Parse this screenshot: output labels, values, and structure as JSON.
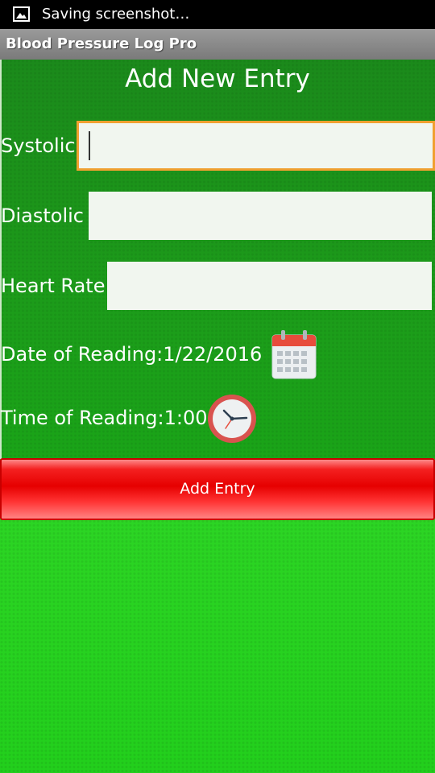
{
  "status_bar": {
    "icon": "image-icon",
    "text": "Saving screenshot…"
  },
  "app": {
    "title": "Blood Pressure Log Pro"
  },
  "form": {
    "heading": "Add New Entry",
    "systolic": {
      "label": "Systolic",
      "value": ""
    },
    "diastolic": {
      "label": "Diastolic",
      "value": ""
    },
    "heart_rate": {
      "label": "Heart Rate",
      "value": ""
    },
    "date": {
      "label": "Date of Reading:1/22/2016",
      "icon": "calendar-icon"
    },
    "time": {
      "label": "Time of Reading:1:00",
      "icon": "clock-icon"
    },
    "submit_label": "Add Entry"
  },
  "colors": {
    "form_background": "#1c9c1a",
    "bottom_background": "#22cf1c",
    "button_red": "#e60000",
    "focus_border": "#f0a030"
  }
}
